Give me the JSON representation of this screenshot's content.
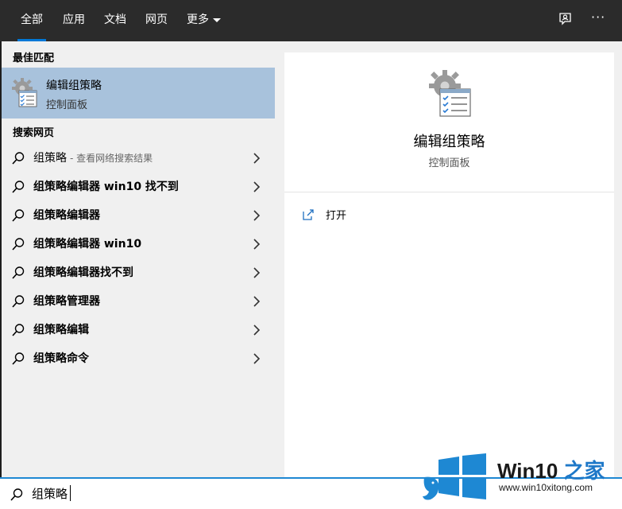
{
  "tabs": [
    {
      "label": "全部",
      "active": true
    },
    {
      "label": "应用"
    },
    {
      "label": "文档"
    },
    {
      "label": "网页"
    },
    {
      "label": "更多"
    }
  ],
  "top_icons": [
    "feedback-icon",
    "more-options-icon"
  ],
  "top_icons_text": {
    "more": "···"
  },
  "left": {
    "best_match_label": "最佳匹配",
    "best_match": {
      "title": "编辑组策略",
      "subtitle": "控制面板",
      "icon": "group-policy-icon"
    },
    "web_label": "搜索网页",
    "web_results": [
      {
        "text": "组策略",
        "hint": "- 查看网络搜索结果"
      },
      {
        "text": "组策略编辑器 win10 找不到"
      },
      {
        "text": "组策略编辑器"
      },
      {
        "text": "组策略编辑器 win10"
      },
      {
        "text": "组策略编辑器找不到"
      },
      {
        "text": "组策略管理器"
      },
      {
        "text": "组策略编辑"
      },
      {
        "text": "组策略命令"
      }
    ]
  },
  "right": {
    "title": "编辑组策略",
    "subtitle": "控制面板",
    "actions": [
      {
        "label": "打开",
        "icon": "open-icon"
      }
    ]
  },
  "search": {
    "value": "组策略",
    "icon": "search-icon"
  },
  "watermark": {
    "title_prefix": "Win10",
    "title_suffix": " 之家",
    "url": "www.win10xitong.com"
  },
  "colors": {
    "topbar": "#2b2b2b",
    "accent": "#0078d7",
    "selected": "#a8c2dc",
    "panel": "#f0f0f0"
  }
}
